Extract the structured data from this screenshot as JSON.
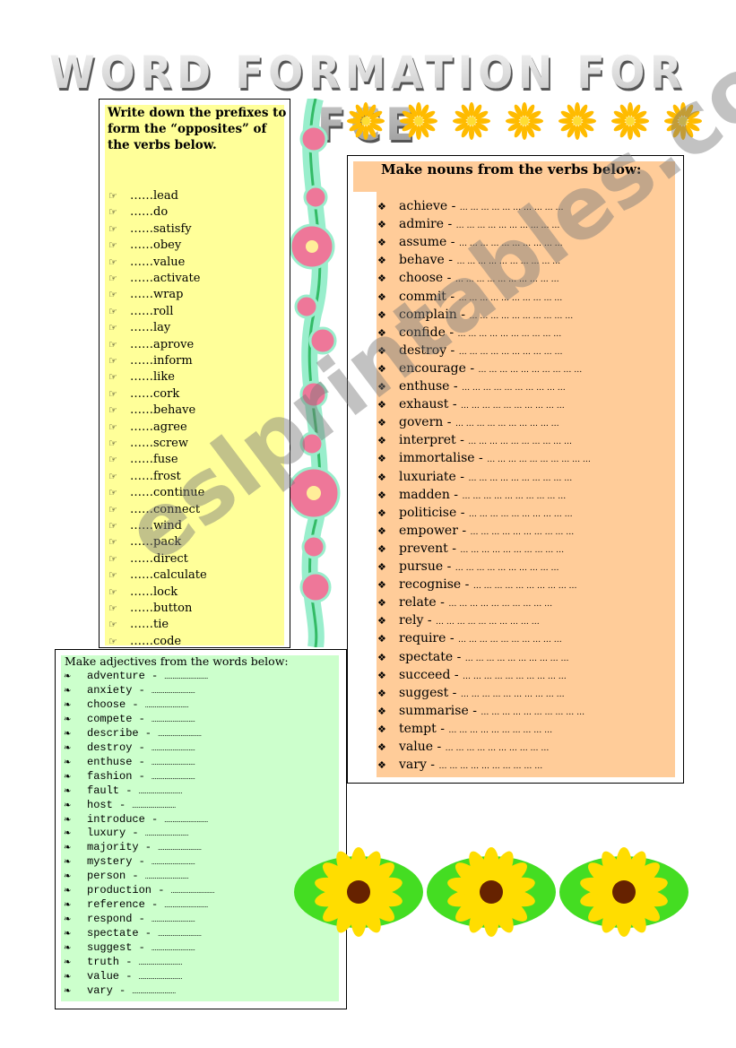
{
  "title": "WORD FORMATION FOR FCE",
  "prefixes": {
    "heading": "Write down the prefixes to form the “opposites” of the verbs below.",
    "blank": "……",
    "bullet_icon": "pointing-hand-icon",
    "items": [
      "lead",
      "do",
      "satisfy",
      "obey",
      "value",
      "activate",
      "wrap",
      "roll",
      "lay",
      "aprove",
      "inform",
      "like",
      "cork",
      "behave",
      "agree",
      "screw",
      "fuse",
      "frost",
      "continue",
      "connect",
      "wind",
      "pack",
      "direct",
      "calculate",
      "lock",
      "button",
      "tie",
      "code"
    ]
  },
  "nouns": {
    "heading": "Make nouns from the verbs below:",
    "bullet_icon": "four-diamond-icon",
    "blank": "… … … … … … … … … …",
    "items": [
      "achieve",
      "admire",
      "assume",
      "behave",
      "choose",
      "commit",
      "complain",
      "confide",
      "destroy",
      "encourage",
      "enthuse",
      "exhaust",
      "govern",
      "interpret",
      "immortalise",
      "luxuriate",
      "madden",
      "politicise",
      "empower",
      "prevent",
      "pursue",
      "recognise",
      "relate",
      "rely",
      "require",
      "spectate",
      "succeed",
      "suggest",
      "summarise",
      "tempt",
      "value",
      "vary"
    ]
  },
  "adjectives": {
    "heading": "Make adjectives from the words below:",
    "bullet_icon": "scroll-ornament-icon",
    "blank": "………………………",
    "items": [
      "adventure",
      "anxiety",
      "choose",
      "compete",
      "describe",
      "destroy",
      "enthuse",
      "fashion",
      "fault",
      "host",
      "introduce",
      "luxury",
      "majority",
      "mystery",
      "person",
      "production",
      "reference",
      "respond",
      "spectate",
      "suggest",
      "truth",
      "value",
      "vary"
    ]
  },
  "watermark": "eslprintables.com",
  "colors": {
    "yellow": "#ffff99",
    "orange": "#ffcc99",
    "green": "#ccffcc"
  }
}
